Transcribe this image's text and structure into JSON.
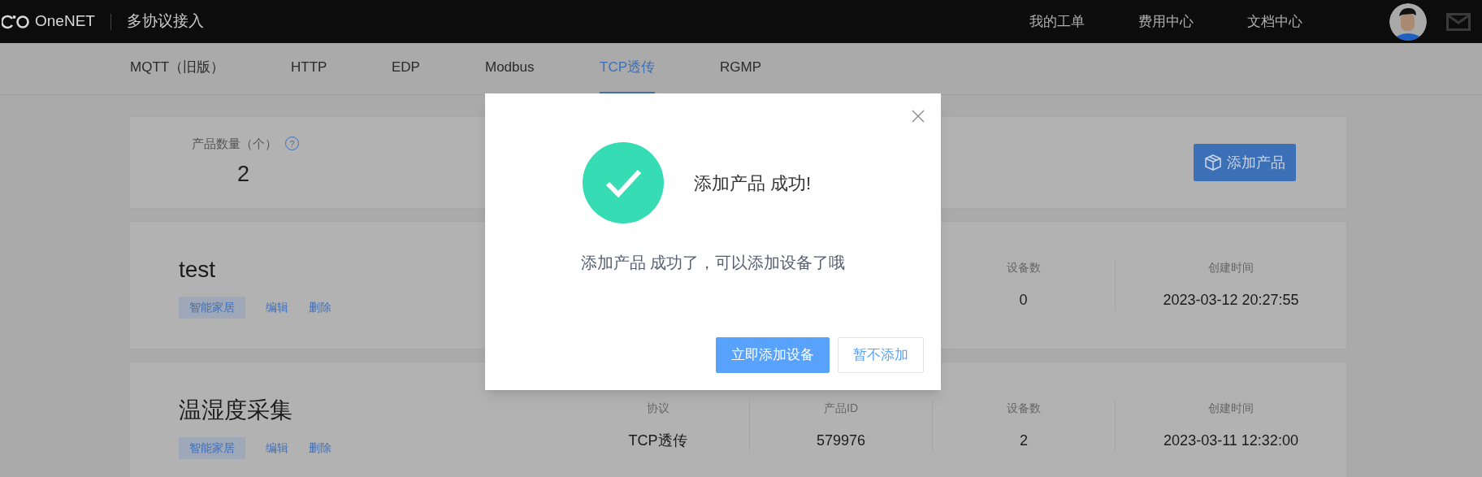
{
  "top_bar": {
    "logo": "OneNET",
    "section": "多协议接入",
    "links": [
      "我的工单",
      "费用中心",
      "文档中心"
    ]
  },
  "tabs": [
    {
      "label": "MQTT（旧版）",
      "selected": false
    },
    {
      "label": "HTTP",
      "selected": false
    },
    {
      "label": "EDP",
      "selected": false
    },
    {
      "label": "Modbus",
      "selected": false
    },
    {
      "label": "TCP透传",
      "selected": true
    },
    {
      "label": "RGMP",
      "selected": false
    }
  ],
  "summary": {
    "label": "产品数量（个）",
    "help": "?",
    "value": "2",
    "add_button": "添加产品"
  },
  "products": [
    {
      "name": "test",
      "tag": "智能家居",
      "actions": [
        "编辑",
        "删除"
      ],
      "stats": [
        {
          "label": "设备数",
          "value": "0"
        },
        {
          "label": "创建时间",
          "value": "2023-03-12 20:27:55"
        }
      ]
    },
    {
      "name": "温湿度采集",
      "tag": "智能家居",
      "actions": [
        "编辑",
        "删除"
      ],
      "stats": [
        {
          "label": "协议",
          "value": "TCP透传"
        },
        {
          "label": "产品ID",
          "value": "579976"
        },
        {
          "label": "设备数",
          "value": "2"
        },
        {
          "label": "创建时间",
          "value": "2023-03-11 12:32:00"
        }
      ]
    }
  ],
  "dialog": {
    "title": "添加产品 成功!",
    "message": "添加产品 成功了，可以添加设备了哦",
    "buttons": [
      {
        "label": "立即添加设备",
        "kind": "primary"
      },
      {
        "label": "暂不添加",
        "kind": "secondary"
      }
    ]
  }
}
